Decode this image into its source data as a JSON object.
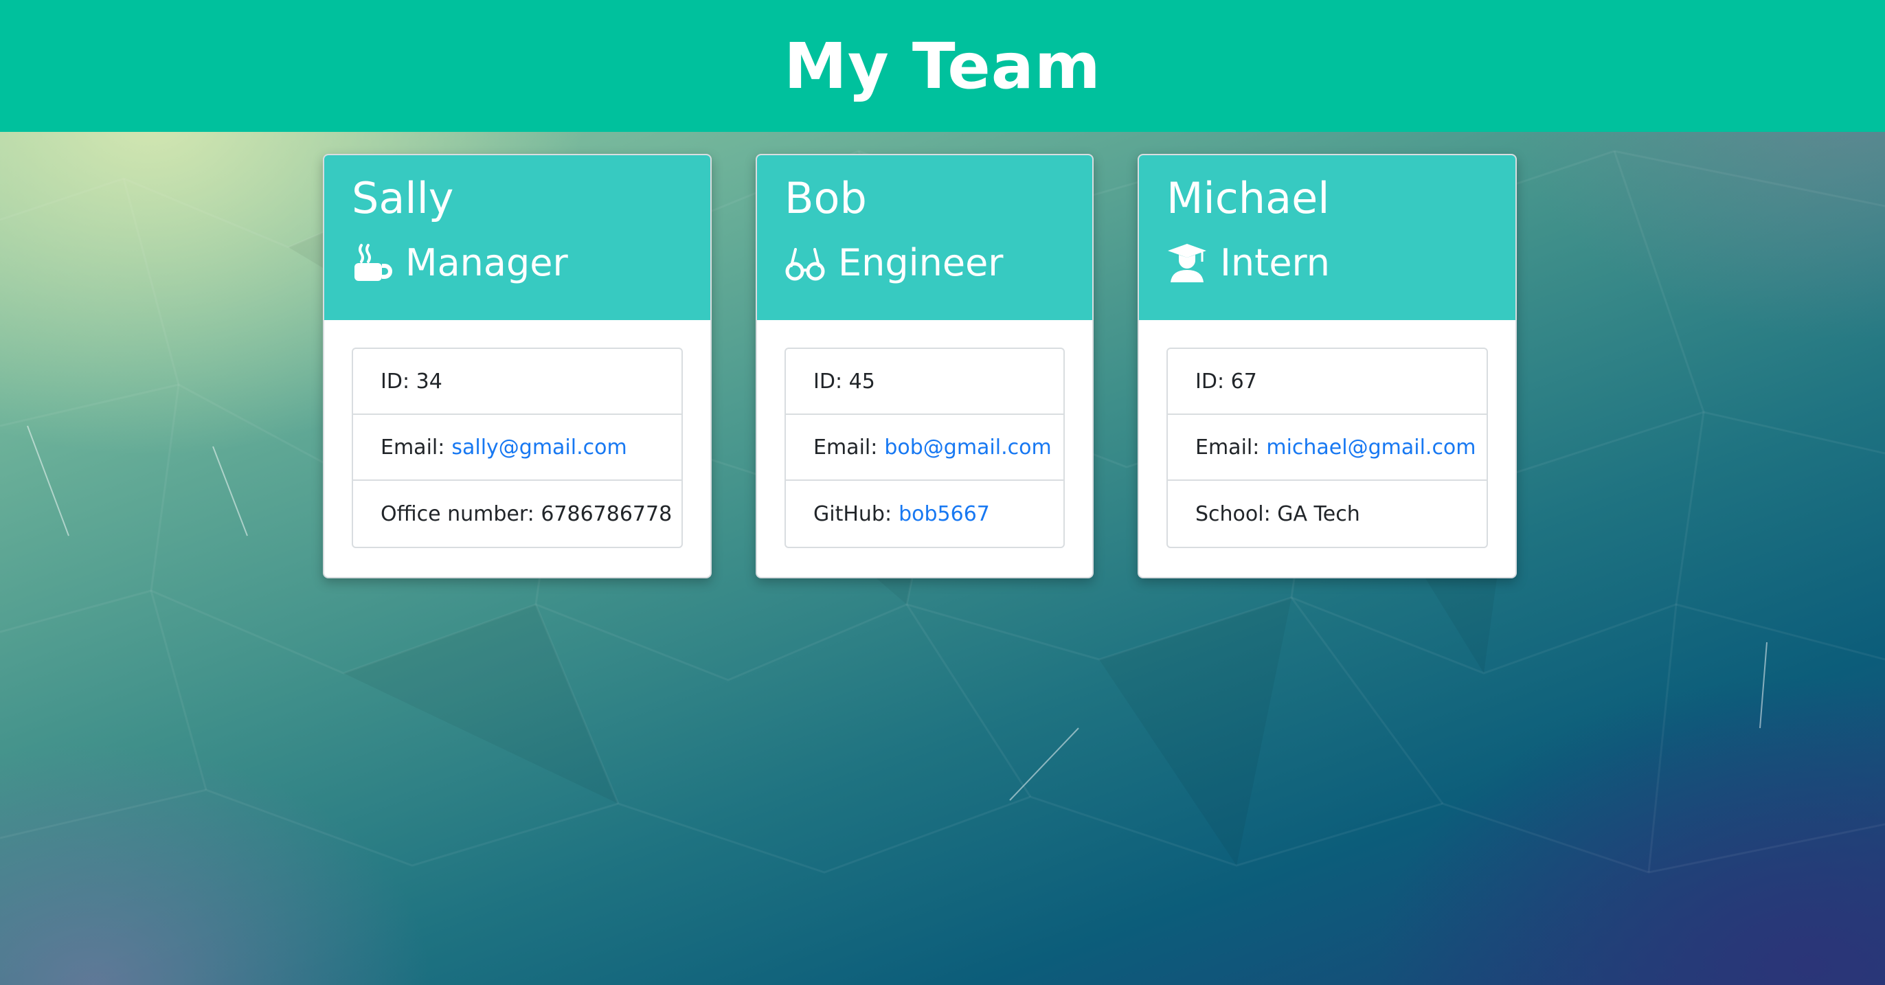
{
  "header": {
    "title": "My Team"
  },
  "colors": {
    "header_bg": "#00c19d",
    "card_header_bg": "#37cac1",
    "link": "#1778f2"
  },
  "cards": [
    {
      "name": "Sally",
      "role": "Manager",
      "role_icon": "coffee-mug-icon",
      "id_label": "ID:",
      "id_value": "34",
      "email_label": "Email:",
      "email": "sally@gmail.com",
      "extra_label": "Office number:",
      "extra_value": "6786786778"
    },
    {
      "name": "Bob",
      "role": "Engineer",
      "role_icon": "glasses-icon",
      "id_label": "ID:",
      "id_value": "45",
      "email_label": "Email:",
      "email": "bob@gmail.com",
      "extra_label": "GitHub:",
      "extra_value": "bob5667"
    },
    {
      "name": "Michael",
      "role": "Intern",
      "role_icon": "graduate-icon",
      "id_label": "ID:",
      "id_value": "67",
      "email_label": "Email:",
      "email": "michael@gmail.com",
      "extra_label": "School:",
      "extra_value": "GA Tech"
    }
  ]
}
